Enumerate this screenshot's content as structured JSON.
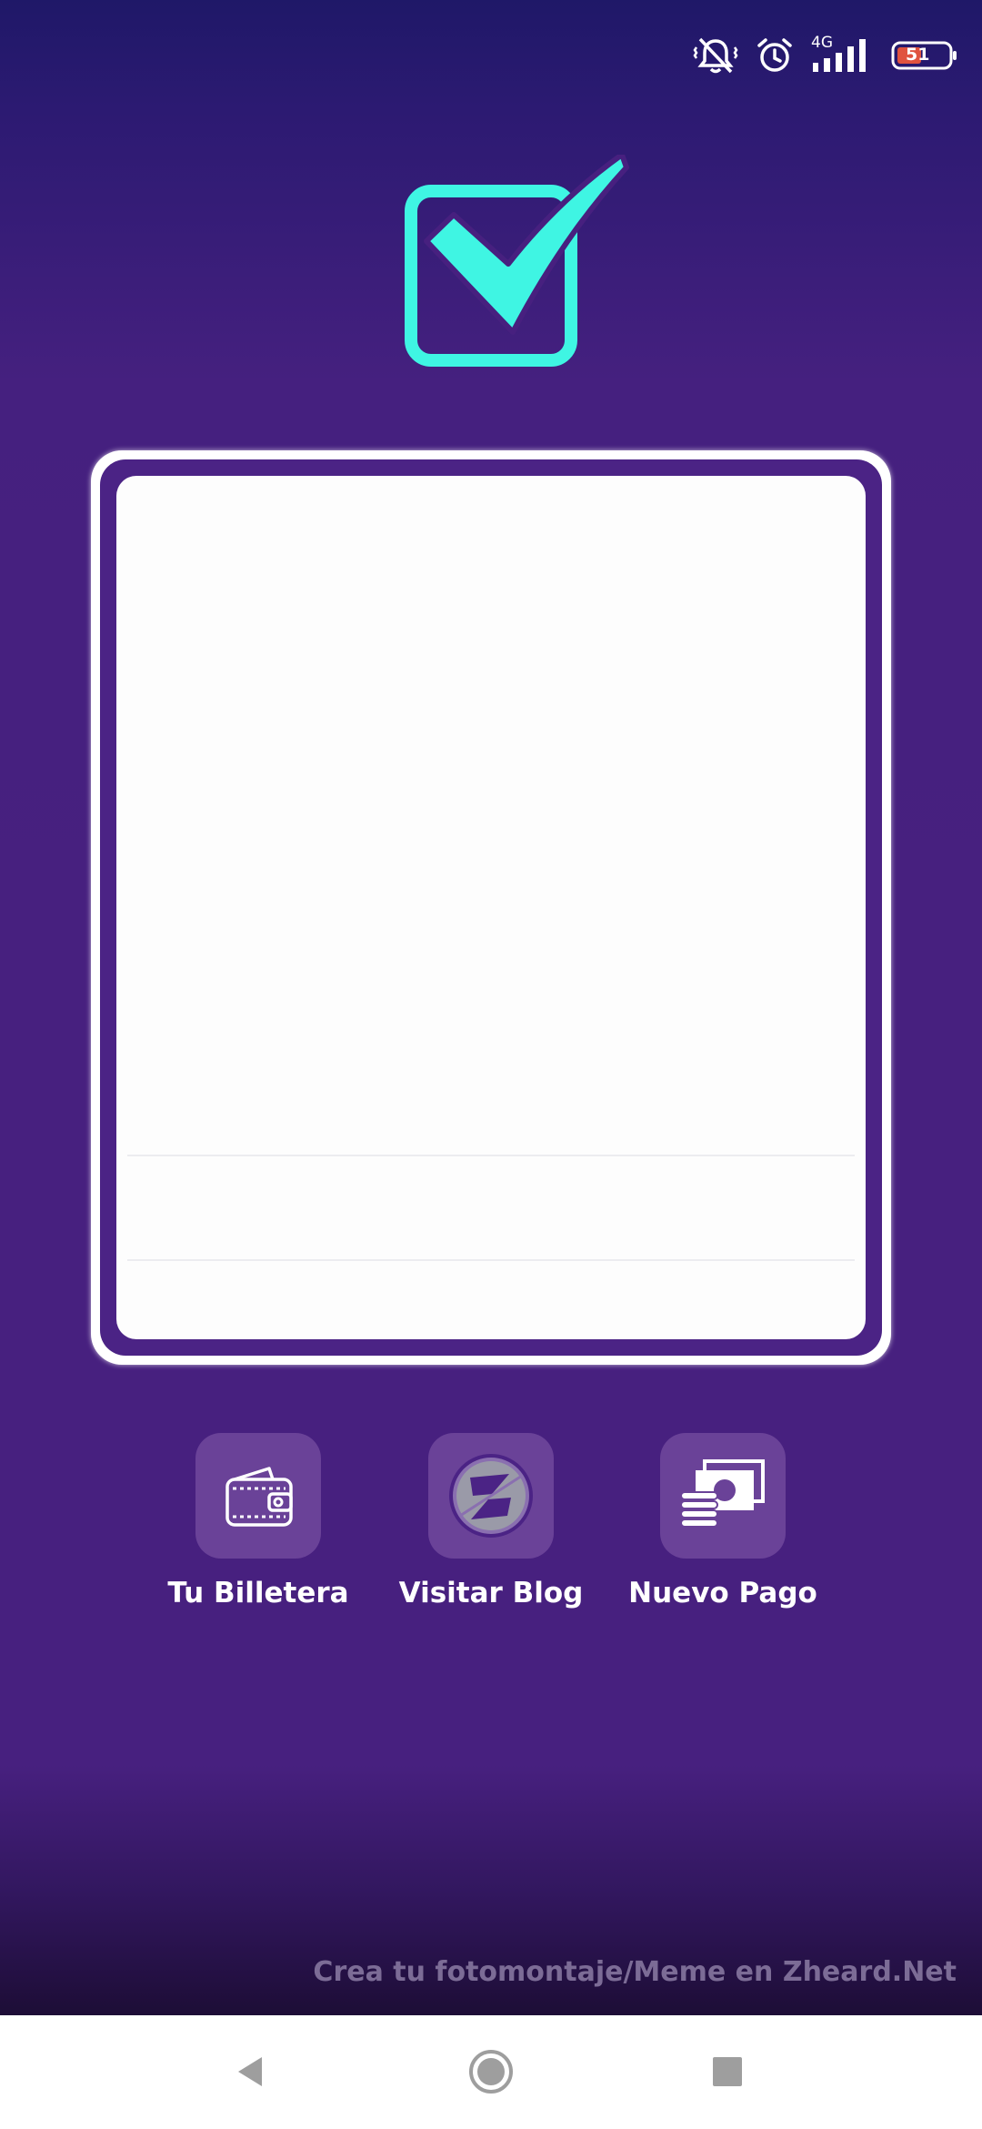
{
  "status_bar": {
    "network": "4G",
    "battery_level": "51",
    "icons": [
      "mute-vibrate-icon",
      "alarm-icon",
      "signal-icon",
      "battery-icon"
    ]
  },
  "hero": {
    "icon": "checkbox-check-icon",
    "color": "#3ff5e3"
  },
  "receipt": {
    "border_color": "#4b2385"
  },
  "actions": [
    {
      "label": "Tu Billetera",
      "icon": "wallet-icon"
    },
    {
      "label": "Visitar Blog",
      "icon": "blog-logo-icon"
    },
    {
      "label": "Nuevo Pago",
      "icon": "money-stack-icon"
    }
  ],
  "watermark": "Crea tu fotomontaje/Meme en Zheard.Net",
  "navigation": {
    "icons": [
      "back-icon",
      "home-icon",
      "recents-icon"
    ]
  },
  "colors": {
    "accent": "#3ff5e3",
    "background": "#47207f",
    "tile": "#6a4298"
  }
}
